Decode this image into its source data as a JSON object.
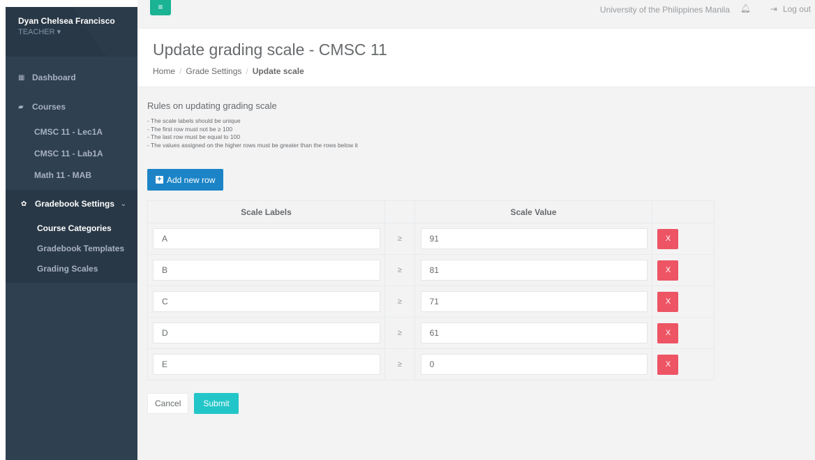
{
  "profile": {
    "name": "Dyan Chelsea Francisco",
    "role": "TEACHER ▾"
  },
  "sidebar": {
    "dashboard": "Dashboard",
    "courses": "Courses",
    "course_items": [
      "CMSC 11 - Lec1A",
      "CMSC 11 - Lab1A",
      "Math 11 - MAB"
    ],
    "gradebook_settings": "Gradebook Settings",
    "gradebook_items": [
      "Course Categories",
      "Gradebook Templates",
      "Grading Scales"
    ]
  },
  "topbar": {
    "menu_icon": "≡",
    "university": "University of the Philippines Manila",
    "logout": "Log out"
  },
  "heading": {
    "title": "Update grading scale - CMSC 11",
    "breadcrumb": [
      "Home",
      "Grade Settings",
      "Update scale"
    ]
  },
  "rules": {
    "title": "Rules on updating grading scale",
    "items": [
      "- The scale labels should be unique",
      "- The first row must not be ≥ 100",
      "- The last row must be equal to 100",
      "- The values assigned on the higher rows must be greater than the rows below it"
    ]
  },
  "add_row_label": "Add new row",
  "table": {
    "headers": [
      "Scale Labels",
      "Scale Value"
    ],
    "ge_symbol": "≥",
    "delete_label": "X",
    "rows": [
      {
        "label": "A",
        "value": "91"
      },
      {
        "label": "B",
        "value": "81"
      },
      {
        "label": "C",
        "value": "71"
      },
      {
        "label": "D",
        "value": "61"
      },
      {
        "label": "E",
        "value": "0"
      }
    ]
  },
  "actions": {
    "cancel": "Cancel",
    "submit": "Submit"
  },
  "colors": {
    "sidebar": "#2f4050",
    "primary": "#1c84c6",
    "danger": "#ed5565",
    "info": "#23c6c8",
    "green": "#1ab394"
  }
}
